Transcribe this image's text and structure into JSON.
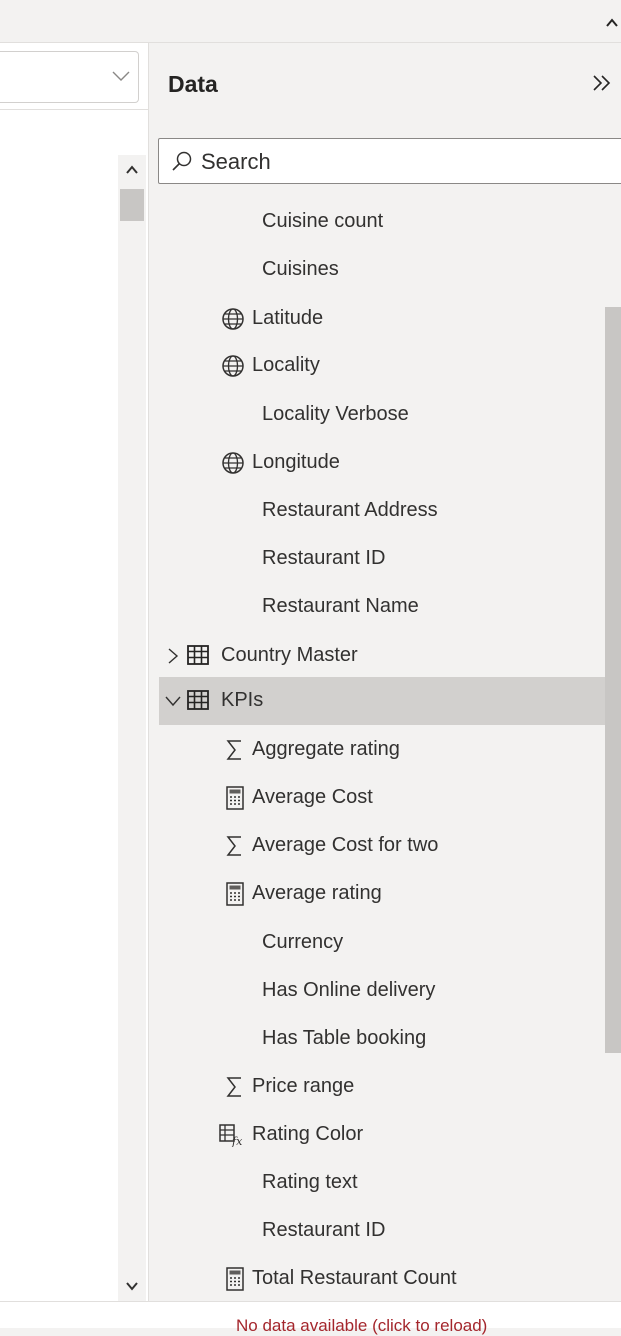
{
  "pane": {
    "title": "Data"
  },
  "search": {
    "placeholder": "Search"
  },
  "fields_top": [
    {
      "label": "Cuisine count",
      "icon": "none"
    },
    {
      "label": "Cuisines",
      "icon": "none"
    },
    {
      "label": "Latitude",
      "icon": "globe-icon"
    },
    {
      "label": "Locality",
      "icon": "globe-icon"
    },
    {
      "label": "Locality Verbose",
      "icon": "none"
    },
    {
      "label": "Longitude",
      "icon": "globe-icon"
    },
    {
      "label": "Restaurant Address",
      "icon": "none"
    },
    {
      "label": "Restaurant ID",
      "icon": "none"
    },
    {
      "label": "Restaurant Name",
      "icon": "none"
    }
  ],
  "tables": [
    {
      "label": "Country Master",
      "expanded": false
    },
    {
      "label": "KPIs",
      "expanded": true,
      "selected": true
    }
  ],
  "kpi_fields": [
    {
      "label": "Aggregate rating",
      "icon": "sigma-icon"
    },
    {
      "label": "Average Cost",
      "icon": "calculator-icon"
    },
    {
      "label": "Average Cost for two",
      "icon": "sigma-icon"
    },
    {
      "label": "Average rating",
      "icon": "calculator-icon"
    },
    {
      "label": "Currency",
      "icon": "none"
    },
    {
      "label": "Has Online delivery",
      "icon": "none"
    },
    {
      "label": "Has Table booking",
      "icon": "none"
    },
    {
      "label": "Price range",
      "icon": "sigma-icon"
    },
    {
      "label": "Rating Color",
      "icon": "calculated-column-icon"
    },
    {
      "label": "Rating text",
      "icon": "none"
    },
    {
      "label": "Restaurant ID",
      "icon": "none"
    },
    {
      "label": "Total Restaurant Count",
      "icon": "calculator-icon"
    }
  ],
  "status": {
    "text": "No data available (click to reload)"
  },
  "colors": {
    "selected_row": "#d2d0ce",
    "pane_bg": "#f3f2f1",
    "status_red": "#a4262c"
  }
}
